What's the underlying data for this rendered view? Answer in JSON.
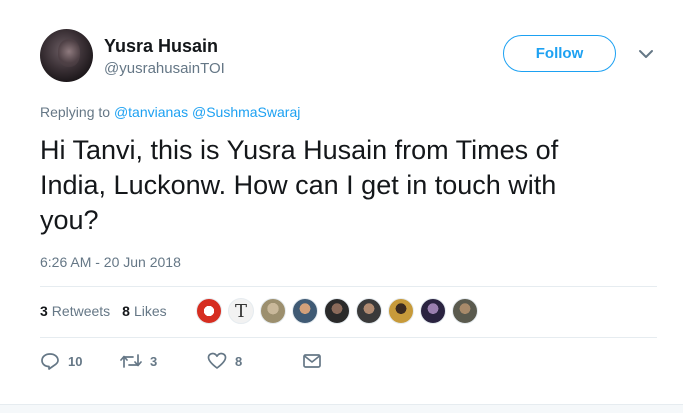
{
  "user": {
    "name": "Yusra Husain",
    "handle": "@yusrahusainTOI"
  },
  "follow_label": "Follow",
  "reply": {
    "prefix": "Replying to",
    "mentions": [
      "@tanvianas",
      "@SushmaSwaraj"
    ]
  },
  "tweet": {
    "line1": "Hi Tanvi, this is Yusra Husain from Times of",
    "line2": "India, Luckonw. How can I get in touch with",
    "line3": "you?"
  },
  "timestamp": "6:26 AM - 20 Jun 2018",
  "stats": {
    "retweets_count": "3",
    "retweets_label": "Retweets",
    "likes_count": "8",
    "likes_label": "Likes"
  },
  "likers": [
    {
      "icon": "liker-avatar-1",
      "color": "#d62d20"
    },
    {
      "icon": "liker-avatar-2",
      "color": "#f2f2f2"
    },
    {
      "icon": "liker-avatar-3",
      "color": "#9c8f6e"
    },
    {
      "icon": "liker-avatar-4",
      "color": "#3f5a74"
    },
    {
      "icon": "liker-avatar-5",
      "color": "#2a2a2a"
    },
    {
      "icon": "liker-avatar-6",
      "color": "#6e5a4a"
    },
    {
      "icon": "liker-avatar-7",
      "color": "#c79a3a"
    },
    {
      "icon": "liker-avatar-8",
      "color": "#4a3b66"
    },
    {
      "icon": "liker-avatar-9",
      "color": "#5a5a4e"
    }
  ],
  "actions": {
    "reply_count": "10",
    "retweet_count": "3",
    "like_count": "8"
  },
  "colors": {
    "accent": "#1da1f2",
    "muted": "#657786",
    "text": "#14171a"
  }
}
